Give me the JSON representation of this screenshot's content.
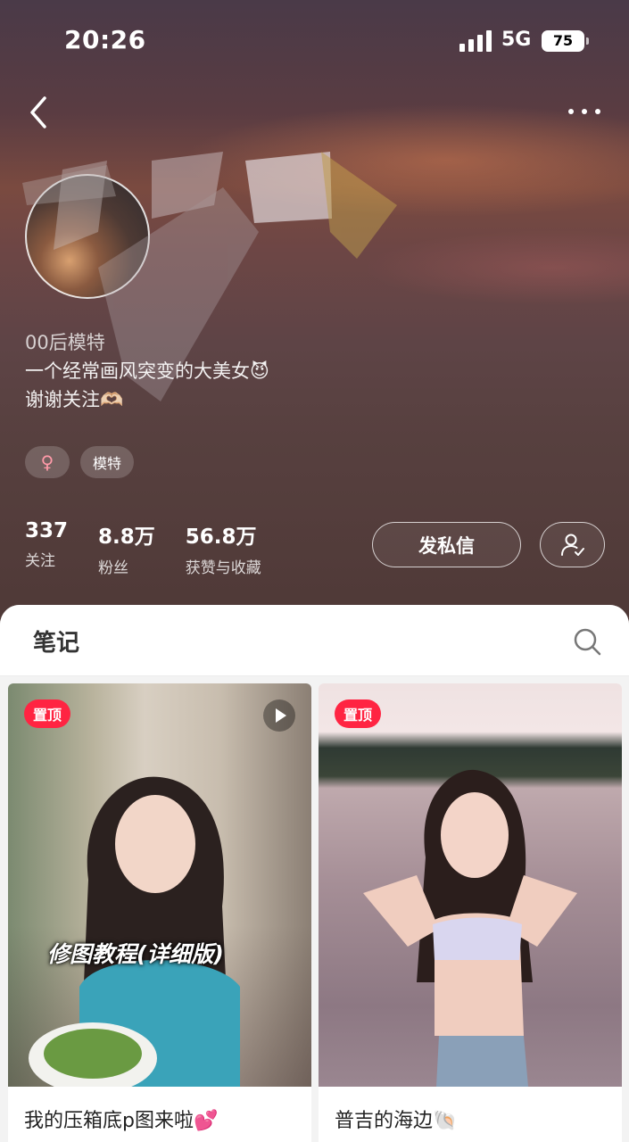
{
  "status_bar": {
    "time": "20:26",
    "network": "5G",
    "battery": "75"
  },
  "profile": {
    "bio_lines": [
      "00后模特",
      "一个经常画风突变的大美女😈",
      "谢谢关注🫶🏻"
    ],
    "gender_symbol": "♀",
    "tags": [
      "模特"
    ],
    "stats": [
      {
        "value": "337",
        "label": "关注"
      },
      {
        "value": "8.8万",
        "label": "粉丝"
      },
      {
        "value": "56.8万",
        "label": "获赞与收藏"
      }
    ],
    "message_button": "发私信"
  },
  "tabs": {
    "notes": "笔记"
  },
  "notes": [
    {
      "pin_label": "置顶",
      "overlay_text": "修图教程(详细版)",
      "title": "我的压箱底p图来啦💕",
      "is_video": true
    },
    {
      "pin_label": "置顶",
      "title": "普吉的海边🐚",
      "is_video": false
    }
  ],
  "colors": {
    "accent": "#ff2442"
  }
}
